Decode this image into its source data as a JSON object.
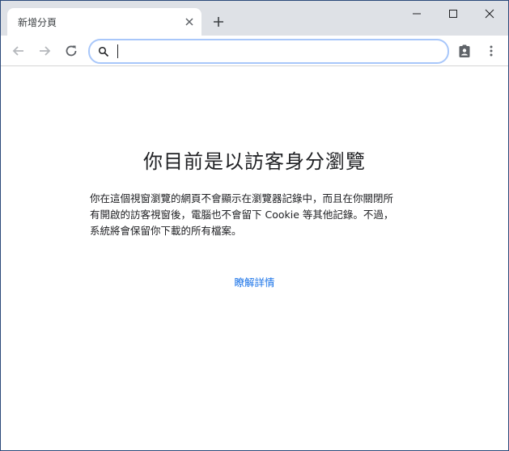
{
  "tab": {
    "title": "新增分頁"
  },
  "omnibox": {
    "value": ""
  },
  "incognito": {
    "heading": "你目前是以訪客身分瀏覽",
    "body_lines": [
      "你在這個視窗瀏覽的網頁不會顯示在瀏覽器記錄中，而且在你關閉所",
      "有開啟的訪客視窗後，電腦也不會留下 Cookie 等其他記錄。不過，",
      "系統將會保留你下載的所有檔案。"
    ],
    "learn_more": "瞭解詳情"
  },
  "colors": {
    "tabstrip": "#dee1e6",
    "link": "#1a73e8",
    "omnibox_focus": "#a8c7fa"
  },
  "icons": {
    "tab_close": "close-icon",
    "new_tab": "plus-icon",
    "minimize": "minimize-icon",
    "maximize": "maximize-icon",
    "close_window": "close-icon",
    "back": "arrow-left-icon",
    "forward": "arrow-right-icon",
    "reload": "reload-icon",
    "search": "search-icon",
    "guest_profile": "guest-badge-icon",
    "menu": "kebab-menu-icon"
  }
}
